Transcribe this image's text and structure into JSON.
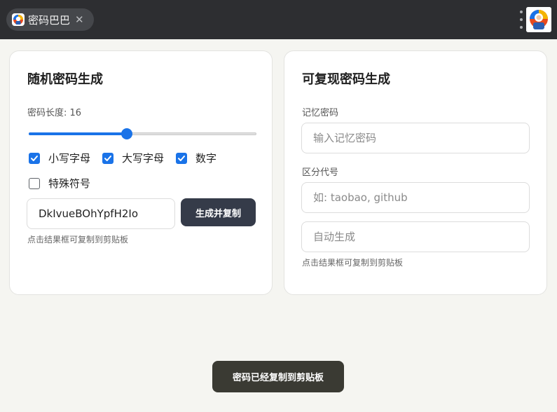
{
  "browser": {
    "tab_title": "密码巴巴",
    "tab_close_glyph": "✕",
    "menu_icon": "kebab-menu-icon",
    "avatar_icon": "profile-avatar-icon"
  },
  "random_card": {
    "title": "随机密码生成",
    "length_label": "密码长度: 16",
    "length_value": 16,
    "length_fraction": 0.43,
    "options": [
      {
        "label": "小写字母",
        "checked": true
      },
      {
        "label": "大写字母",
        "checked": true
      },
      {
        "label": "数字",
        "checked": true
      },
      {
        "label": "特殊符号",
        "checked": false
      }
    ],
    "result_value": "DkIvueBOhYpfH2Io",
    "generate_button": "生成并复制",
    "hint": "点击结果框可复制到剪贴板"
  },
  "reproducible_card": {
    "title": "可复现密码生成",
    "memory_label": "记忆密码",
    "memory_placeholder": "输入记忆密码",
    "code_label": "区分代号",
    "code_placeholder": "如: taobao, github",
    "result_placeholder": "自动生成",
    "hint": "点击结果框可复制到剪贴板"
  },
  "toast": {
    "message": "密码已经复制到剪贴板"
  },
  "colors": {
    "accent": "#1a73e8",
    "button_dark": "#353b49",
    "toast_bg": "#3a3a33",
    "topbar_bg": "#2d2e31"
  }
}
